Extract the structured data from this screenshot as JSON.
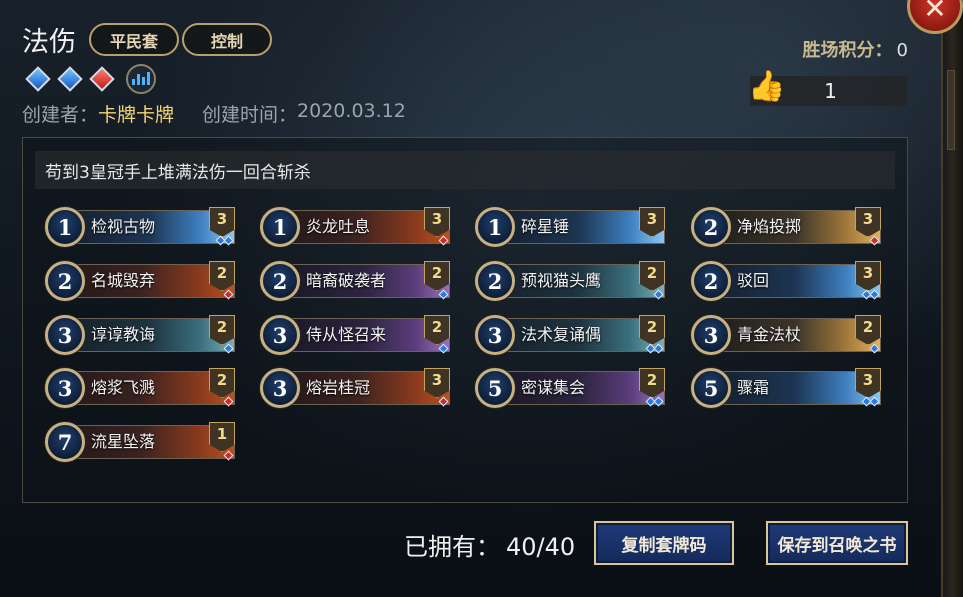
{
  "header": {
    "deck_title": "法伤",
    "tags": [
      "平民套",
      "控制"
    ],
    "regions": [
      "blue",
      "blue",
      "red"
    ],
    "stats_icon": "bar-chart-icon",
    "creator_label": "创建者：",
    "creator_name": "卡牌卡牌",
    "created_label": "创建时间：",
    "created_date": "2020.03.12"
  },
  "score": {
    "label": "胜场积分：",
    "value": "0"
  },
  "likes": {
    "icon": "thumbs-up-icon",
    "count": "1"
  },
  "deck": {
    "description": "苟到3皇冠手上堆满法伤一回合斩杀",
    "cards": [
      {
        "cost": "1",
        "name": "检视古物",
        "qty": "3",
        "regions": [
          "blue",
          "blue"
        ],
        "art": "art-blue"
      },
      {
        "cost": "1",
        "name": "炎龙吐息",
        "qty": "3",
        "regions": [
          "red"
        ],
        "art": "art-red"
      },
      {
        "cost": "1",
        "name": "碎星锤",
        "qty": "3",
        "regions": [],
        "art": "art-blue"
      },
      {
        "cost": "2",
        "name": "净焰投掷",
        "qty": "3",
        "regions": [
          "red"
        ],
        "art": "art-gold"
      },
      {
        "cost": "2",
        "name": "名城毁弃",
        "qty": "2",
        "regions": [
          "red"
        ],
        "art": "art-red"
      },
      {
        "cost": "2",
        "name": "暗裔破袭者",
        "qty": "2",
        "regions": [
          "blue"
        ],
        "art": "art-purple"
      },
      {
        "cost": "2",
        "name": "预视猫头鹰",
        "qty": "2",
        "regions": [
          "blue"
        ],
        "art": "art-teal"
      },
      {
        "cost": "2",
        "name": "驳回",
        "qty": "3",
        "regions": [
          "blue",
          "blue"
        ],
        "art": "art-blue"
      },
      {
        "cost": "3",
        "name": "谆谆教诲",
        "qty": "2",
        "regions": [
          "blue"
        ],
        "art": "art-teal"
      },
      {
        "cost": "3",
        "name": "侍从怪召来",
        "qty": "2",
        "regions": [
          "blue"
        ],
        "art": "art-purple"
      },
      {
        "cost": "3",
        "name": "法术复诵偶",
        "qty": "2",
        "regions": [
          "blue",
          "blue"
        ],
        "art": "art-teal"
      },
      {
        "cost": "3",
        "name": "青金法杖",
        "qty": "2",
        "regions": [
          "blue"
        ],
        "art": "art-gold"
      },
      {
        "cost": "3",
        "name": "熔浆飞溅",
        "qty": "2",
        "regions": [
          "red"
        ],
        "art": "art-red"
      },
      {
        "cost": "3",
        "name": "熔岩桂冠",
        "qty": "3",
        "regions": [
          "red"
        ],
        "art": "art-red"
      },
      {
        "cost": "5",
        "name": "密谋集会",
        "qty": "2",
        "regions": [
          "blue",
          "blue"
        ],
        "art": "art-purple"
      },
      {
        "cost": "5",
        "name": "骤霜",
        "qty": "3",
        "regions": [
          "blue",
          "blue"
        ],
        "art": "art-blue"
      },
      {
        "cost": "7",
        "name": "流星坠落",
        "qty": "1",
        "regions": [
          "red"
        ],
        "art": "art-red"
      }
    ]
  },
  "footer": {
    "owned_label": "已拥有：",
    "owned_value": "40/40",
    "copy_button": "复制套牌码",
    "save_button": "保存到召唤之书"
  },
  "close_icon": "close-icon"
}
